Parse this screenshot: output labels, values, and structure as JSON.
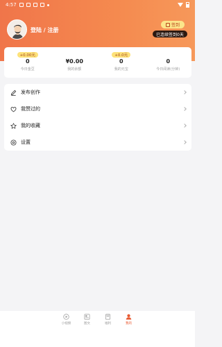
{
  "status_bar": {
    "time": "4:57"
  },
  "profile": {
    "login_text": "登陆 / 注册"
  },
  "checkin": {
    "button_label": "签到",
    "streak_text": "已连续签到0天"
  },
  "stats": [
    {
      "pill": "+0.00元",
      "value": "0",
      "label": "今日金豆"
    },
    {
      "pill": "",
      "value": "¥0.00",
      "label": "我的余额"
    },
    {
      "pill": "+0.0元",
      "value": "0",
      "label": "我的元宝"
    },
    {
      "pill": "",
      "value": "0",
      "label": "今日阅读(分钟)"
    }
  ],
  "menu": [
    {
      "label": "发布创作",
      "icon": "pencil-icon"
    },
    {
      "label": "我赞过的",
      "icon": "heart-icon"
    },
    {
      "label": "我的收藏",
      "icon": "star-icon"
    },
    {
      "label": "设置",
      "icon": "gear-icon"
    }
  ],
  "tabs": [
    {
      "label": "小视频",
      "icon": "play-icon",
      "active": false
    },
    {
      "label": "图文",
      "icon": "article-icon",
      "active": false
    },
    {
      "label": "福利",
      "icon": "gift-icon",
      "active": false
    },
    {
      "label": "我的",
      "icon": "user-icon",
      "active": true
    }
  ],
  "colors": {
    "header_start": "#f0754a",
    "header_end": "#f6985a",
    "accent": "#e85a32",
    "pill": "#fde27a"
  }
}
